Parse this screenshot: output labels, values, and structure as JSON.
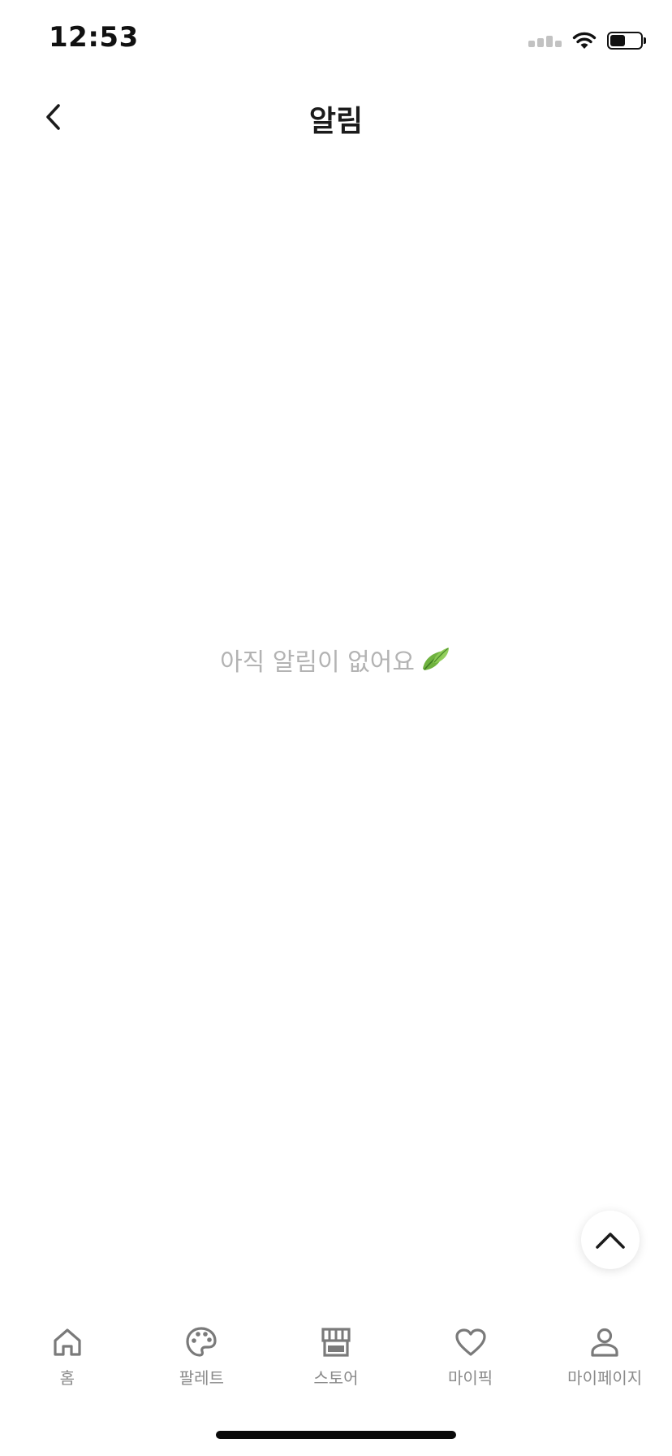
{
  "status_bar": {
    "time": "12:53",
    "battery_level": 0.5
  },
  "header": {
    "title": "알림",
    "back_icon": "chevron-left-icon"
  },
  "empty_state": {
    "message": "아직 알림이 없어요",
    "emoji_icon": "leaf-icon"
  },
  "scroll_top": {
    "icon": "chevron-up-icon"
  },
  "tabs": [
    {
      "label": "홈",
      "icon": "home-icon"
    },
    {
      "label": "팔레트",
      "icon": "palette-icon"
    },
    {
      "label": "스토어",
      "icon": "store-icon"
    },
    {
      "label": "마이픽",
      "icon": "heart-icon"
    },
    {
      "label": "마이페이지",
      "icon": "person-icon"
    }
  ],
  "colors": {
    "text_primary": "#1b1b1b",
    "text_muted": "#b3b3b3",
    "tab_gray": "#8a8a8a",
    "leaf_green": "#5fa83a"
  }
}
